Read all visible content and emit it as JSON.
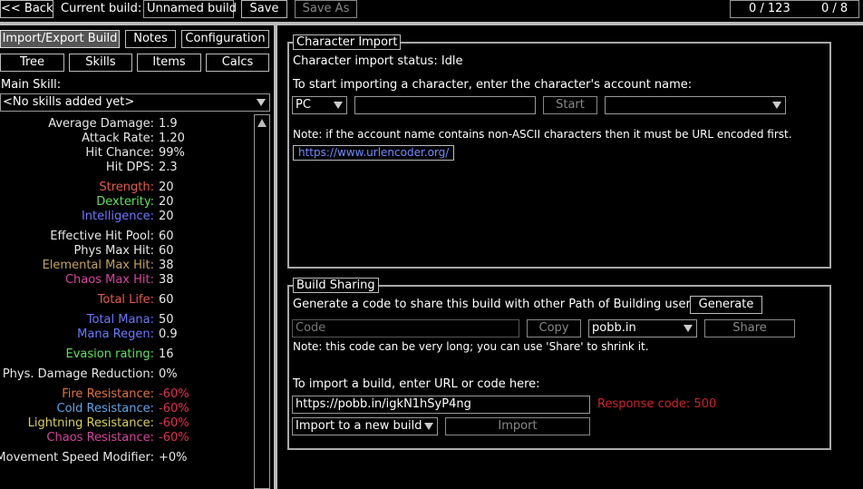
{
  "topbar": {
    "back_label": "<< Back",
    "current_build_label": "Current build:",
    "build_name": "Unnamed build",
    "save_label": "Save",
    "save_as_label": "Save As",
    "points_text": "0 / 123",
    "ascend_text": "0 / 8"
  },
  "nav": {
    "import_export": "Import/Export Build",
    "notes": "Notes",
    "configuration": "Configuration",
    "tree": "Tree",
    "skills": "Skills",
    "items": "Items",
    "calcs": "Calcs"
  },
  "main_skill": {
    "label": "Main Skill:",
    "value": "<No skills added yet>"
  },
  "stats": [
    {
      "label": "Average Damage:",
      "value": "1.9",
      "color": "#e8e8e8"
    },
    {
      "label": "Attack Rate:",
      "value": "1.20",
      "color": "#e8e8e8"
    },
    {
      "label": "Hit Chance:",
      "value": "99%",
      "color": "#e8e8e8"
    },
    {
      "label": "Hit DPS:",
      "value": "2.3",
      "color": "#e8e8e8"
    },
    {
      "label": "Strength:",
      "value": "20",
      "color": "#e35c4a"
    },
    {
      "label": "Dexterity:",
      "value": "20",
      "color": "#5fe05f"
    },
    {
      "label": "Intelligence:",
      "value": "20",
      "color": "#6a78ff"
    },
    {
      "label": "Effective Hit Pool:",
      "value": "60",
      "color": "#e8e8e8"
    },
    {
      "label": "Phys Max Hit:",
      "value": "60",
      "color": "#e8e8e8"
    },
    {
      "label": "Elemental Max Hit:",
      "value": "38",
      "color": "#c2a35b"
    },
    {
      "label": "Chaos Max Hit:",
      "value": "38",
      "color": "#d6449f"
    },
    {
      "label": "Total Life:",
      "value": "60",
      "color": "#e35c4a"
    },
    {
      "label": "Total Mana:",
      "value": "50",
      "color": "#6a78ff"
    },
    {
      "label": "Mana Regen:",
      "value": "0.9",
      "color": "#6a78ff"
    },
    {
      "label": "Evasion rating:",
      "value": "16",
      "color": "#5fe05f"
    },
    {
      "label": "Phys. Damage Reduction:",
      "value": "0%",
      "color": "#e8e8e8"
    },
    {
      "label": "Fire Resistance:",
      "value": "-60%",
      "color": "#e0743c"
    },
    {
      "label": "Cold Resistance:",
      "value": "-60%",
      "color": "#5fa6e8"
    },
    {
      "label": "Lightning Resistance:",
      "value": "-60%",
      "color": "#d9cf5b"
    },
    {
      "label": "Chaos Resistance:",
      "value": "-60%",
      "color": "#d6449f"
    },
    {
      "label": "Movement Speed Modifier:",
      "value": "+0%",
      "color": "#e8e8e8"
    }
  ],
  "negative_color": "#e0304a",
  "link_color": "#6f8cff",
  "character_import": {
    "title": "Character Import",
    "status": "Character import status: Idle",
    "instruction": "To start importing a character, enter the character's account name:",
    "realm": "PC",
    "account_name": "",
    "start_label": "Start",
    "league": "",
    "note": "Note: if the account name contains non-ASCII characters then it must be URL encoded first.",
    "link": "https://www.urlencoder.org/"
  },
  "build_sharing": {
    "title": "Build Sharing",
    "generate_text": "Generate a code to share this build with other Path of Building users:",
    "generate_label": "Generate",
    "code_placeholder": "Code",
    "copy_label": "Copy",
    "site": "pobb.in",
    "share_label": "Share",
    "note": "Note: this code can be very long; you can use 'Share' to shrink it.",
    "import_prompt": "To import a build, enter URL or code here:",
    "import_value": "https://pobb.in/igkN1hSyP4ng",
    "response": "Response code: 500",
    "import_mode": "Import to a new build",
    "import_label": "Import"
  }
}
